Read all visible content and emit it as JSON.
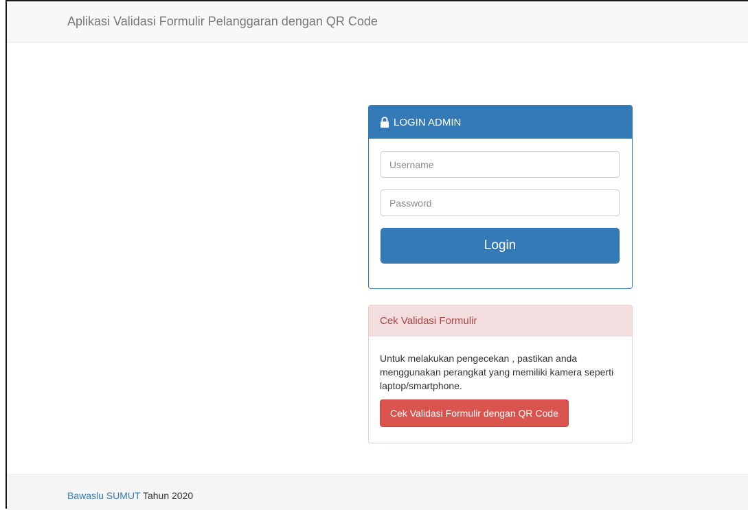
{
  "navbar": {
    "brand": "Aplikasi Validasi Formulir Pelanggaran dengan QR Code"
  },
  "login_panel": {
    "title": "LOGIN ADMIN",
    "icon": "lock-icon",
    "username_placeholder": "Username",
    "username_value": "",
    "password_placeholder": "Password",
    "password_value": "",
    "login_button": "Login"
  },
  "validation_panel": {
    "title": "Cek Validasi Formulir",
    "description": "Untuk melakukan pengecekan , pastikan anda menggunakan perangkat yang memiliki kamera seperti laptop/smartphone.",
    "button": "Cek Validasi Formulir dengan QR Code"
  },
  "footer": {
    "link": "Bawaslu SUMUT",
    "suffix": " Tahun 2020"
  },
  "colors": {
    "primary": "#337ab7",
    "danger": "#d9534f",
    "danger_heading_bg": "#f2dede",
    "danger_heading_text": "#a94442",
    "navbar_bg": "#f8f8f8",
    "footer_bg": "#f5f5f5"
  }
}
